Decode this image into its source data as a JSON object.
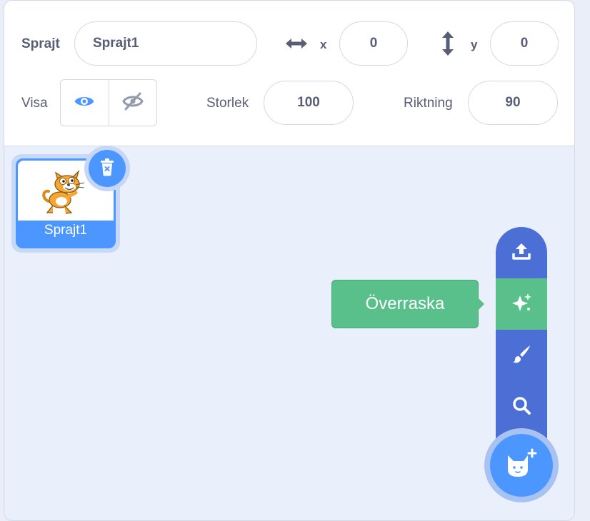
{
  "sprite_info": {
    "sprite_label": "Sprajt",
    "sprite_name": "Sprajt1",
    "x_label": "x",
    "x_value": "0",
    "y_label": "y",
    "y_value": "0",
    "show_label": "Visa",
    "size_label": "Storlek",
    "size_value": "100",
    "direction_label": "Riktning",
    "direction_value": "90"
  },
  "sprites": [
    {
      "name": "Sprajt1",
      "selected": true,
      "icon": "cat-sprite-thumbnail"
    }
  ],
  "sprite_menu": {
    "items": [
      {
        "icon": "upload-icon"
      },
      {
        "icon": "sparkle-icon",
        "active": true
      },
      {
        "icon": "paintbrush-icon"
      },
      {
        "icon": "search-icon"
      }
    ],
    "main_icon": "cat-add-icon"
  },
  "tooltip": {
    "text": "Överraska"
  },
  "colors": {
    "accent": "#4c97ff",
    "menu_blue": "#4c6fd5",
    "surprise_green": "#59c08c",
    "text": "#575e75"
  }
}
